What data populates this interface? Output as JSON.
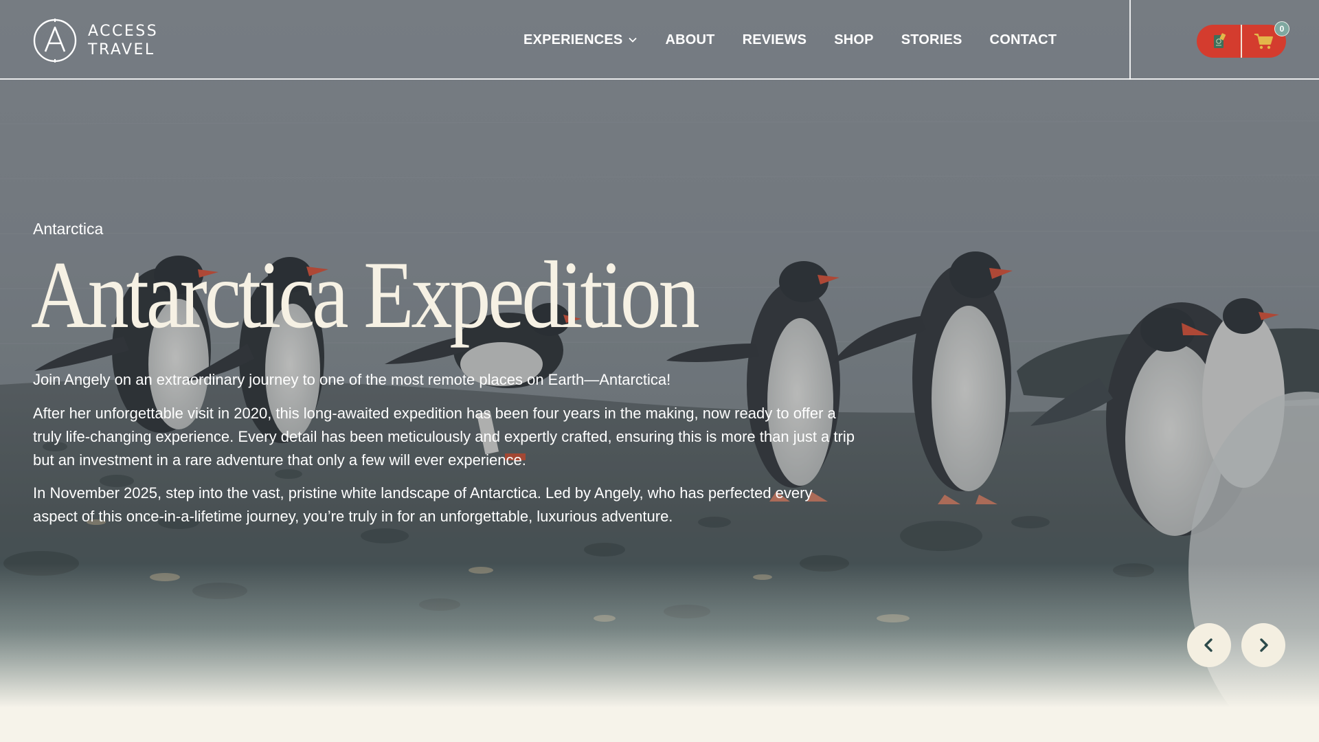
{
  "brand": {
    "logo_line1": "ACCESS",
    "logo_line2": "TRAVEL"
  },
  "nav": {
    "items": [
      {
        "label": "EXPERIENCES",
        "has_dropdown": true
      },
      {
        "label": "ABOUT"
      },
      {
        "label": "REVIEWS"
      },
      {
        "label": "SHOP"
      },
      {
        "label": "STORIES"
      },
      {
        "label": "CONTACT"
      }
    ]
  },
  "actions": {
    "passport_icon": "passport-icon",
    "cart_icon": "shopping-cart-icon",
    "cart_count": "0"
  },
  "hero": {
    "eyebrow": "Antarctica",
    "title": "Antarctica Expedition",
    "paragraphs": [
      "Join Angely on an extraordinary journey to one of the most remote places on Earth—Antarctica!",
      "After her unforgettable visit in 2020, this long-awaited expedition has been four years in the making, now ready to offer a truly life-changing experience. Every detail has been meticulously and expertly crafted, ensuring this is more than just a trip but an investment in a rare adventure that only a few will ever experience.",
      "In November 2025, step into the vast, pristine white landscape of Antarctica. Led by Angely, who has perfected every aspect of this once-in-a-lifetime journey, you’re truly in for an unforgettable, luxurious adventure."
    ],
    "prev_icon": "chevron-left-icon",
    "next_icon": "chevron-right-icon"
  },
  "colors": {
    "accent_red": "#d43c2e",
    "cream": "#f6f3ea",
    "title_cream": "#f6f1e4",
    "arrow_icon": "#2c4a4a",
    "badge_teal": "#7fa8a0"
  }
}
